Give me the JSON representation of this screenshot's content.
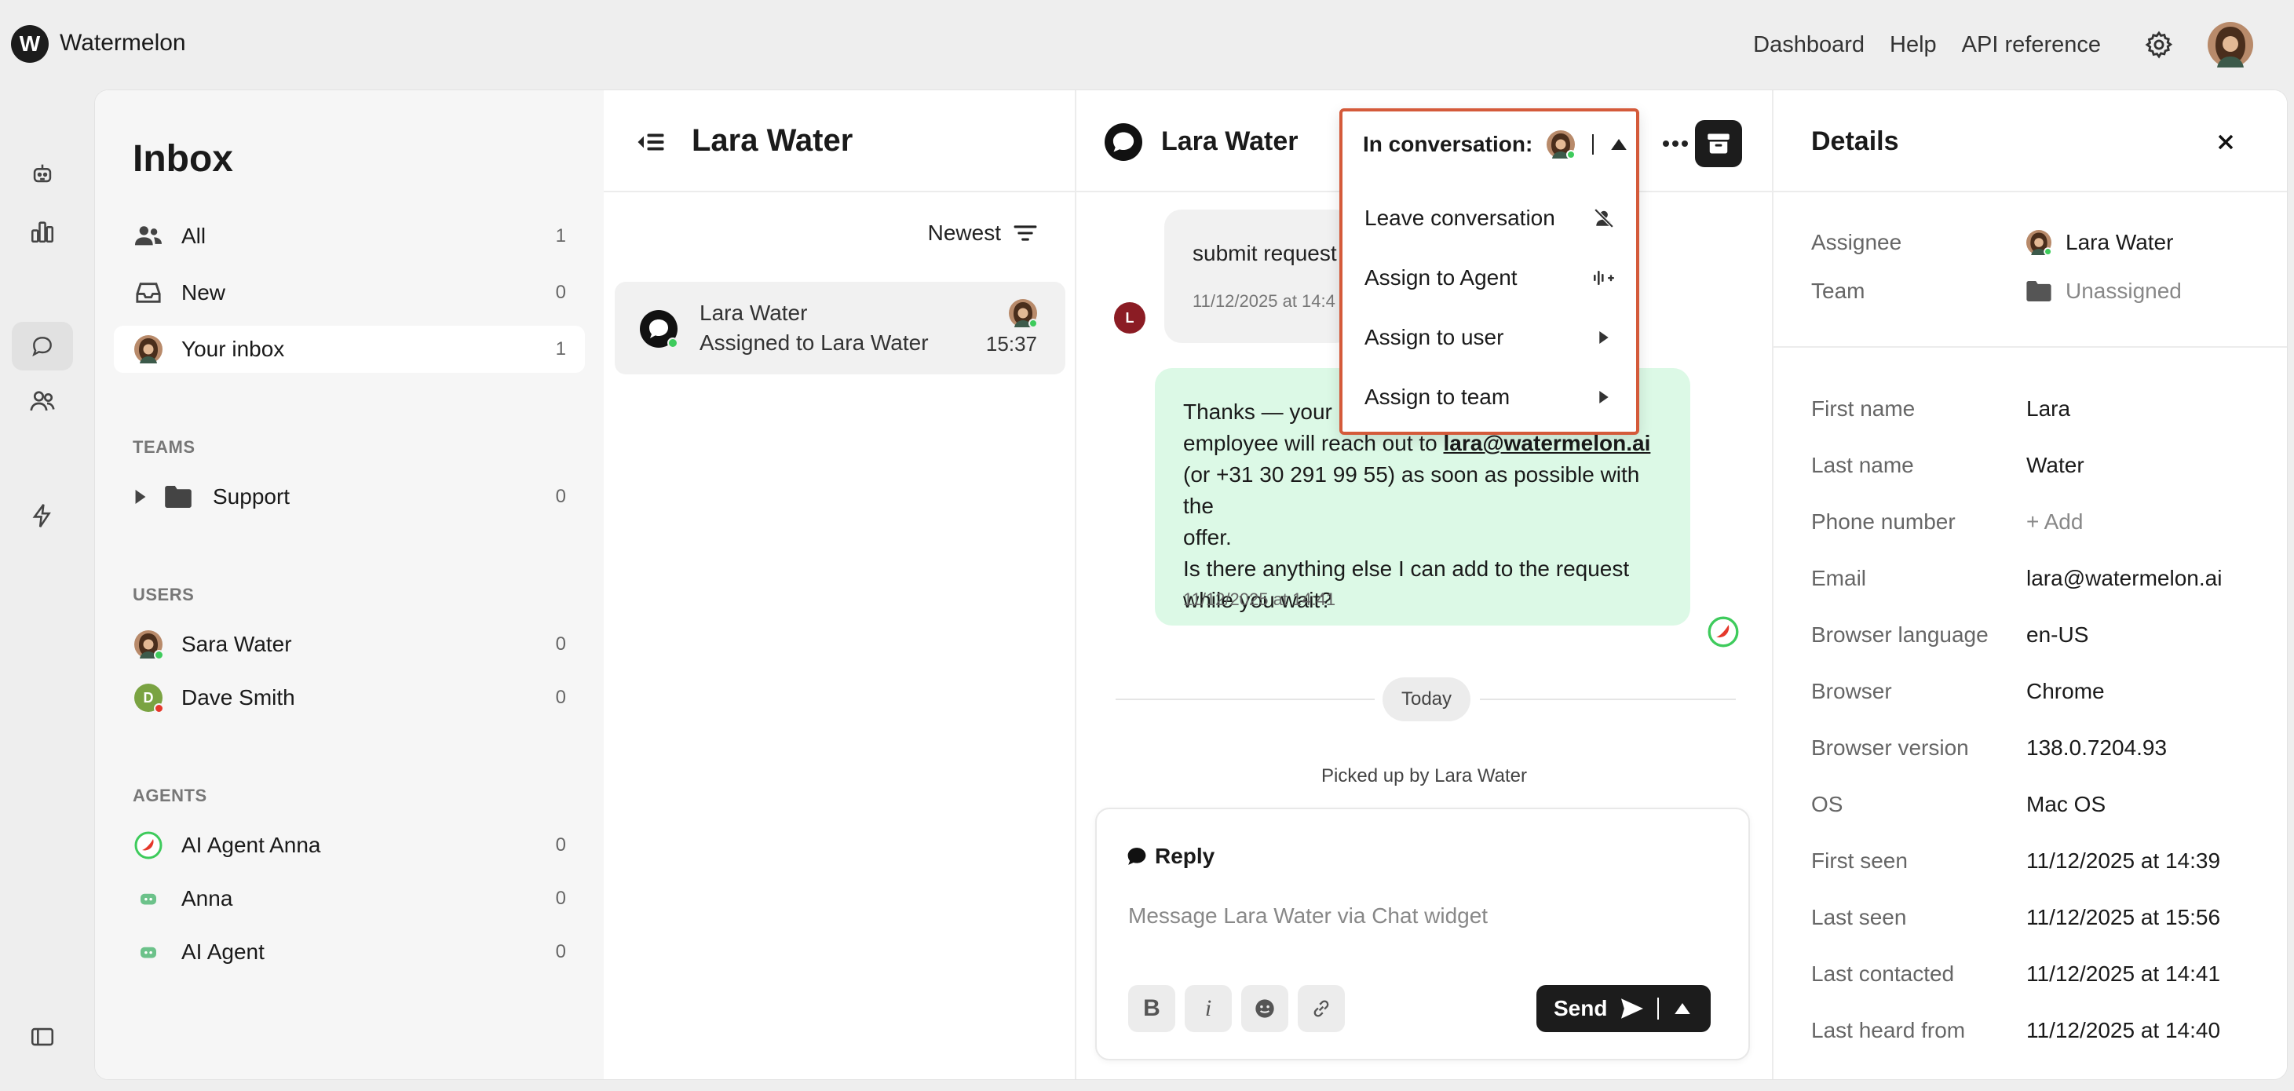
{
  "app": {
    "logo_letter": "W",
    "name": "Watermelon"
  },
  "topnav": {
    "links": [
      "Dashboard",
      "Help",
      "API reference"
    ]
  },
  "inbox": {
    "title": "Inbox",
    "items": [
      {
        "label": "All",
        "count": "1"
      },
      {
        "label": "New",
        "count": "0"
      },
      {
        "label": "Your inbox",
        "count": "1"
      }
    ],
    "teams_title": "TEAMS",
    "teams": [
      {
        "label": "Support",
        "count": "0"
      }
    ],
    "users_title": "USERS",
    "users": [
      {
        "label": "Sara Water",
        "count": "0",
        "initial": "",
        "status_color": "#3ecb5c"
      },
      {
        "label": "Dave Smith",
        "count": "0",
        "initial": "D",
        "status_color": "#e5382b"
      }
    ],
    "agents_title": "AGENTS",
    "agents": [
      {
        "label": "AI Agent Anna",
        "count": "0"
      },
      {
        "label": "Anna",
        "count": "0"
      },
      {
        "label": "AI Agent",
        "count": "0"
      }
    ]
  },
  "list": {
    "title": "Lara Water",
    "sort_label": "Newest",
    "conversation": {
      "name": "Lara Water",
      "subtitle": "Assigned to Lara Water",
      "time": "15:37"
    }
  },
  "conversation": {
    "title": "Lara Water",
    "in_conversation_label": "In conversation:",
    "user_message": {
      "text": "submit request",
      "time": "11/12/2025 at 14:4",
      "avatar_initial": "L"
    },
    "agent_message": {
      "line1": "Thanks — your r",
      "line2_prefix": "employee will reach out to ",
      "email": "lara@watermelon.ai",
      "line3": "(or +31 30 291 99 55) as soon as possible with the",
      "line4": "offer.",
      "line5": "Is there anything else I can add to the request",
      "line6": "while you wait?",
      "time": "11/12/2025 at 14:41"
    },
    "date_divider": "Today",
    "system_note": "Picked up by Lara Water",
    "reply": {
      "label": "Reply",
      "placeholder": "Message Lara Water via Chat widget",
      "bold": "B",
      "italic": "i",
      "send_label": "Send"
    }
  },
  "dropdown": {
    "trigger_label": "In conversation:",
    "items": [
      {
        "label": "Leave conversation",
        "icon": "user-remove-icon"
      },
      {
        "label": "Assign to Agent",
        "icon": "agent-assign-icon"
      },
      {
        "label": "Assign to user",
        "icon": "caret-right-icon"
      },
      {
        "label": "Assign to team",
        "icon": "caret-right-icon"
      }
    ]
  },
  "details": {
    "title": "Details",
    "assignee_label": "Assignee",
    "assignee_value": "Lara Water",
    "team_label": "Team",
    "team_value": "Unassigned",
    "fields": [
      {
        "key": "First name",
        "value": "Lara"
      },
      {
        "key": "Last name",
        "value": "Water"
      },
      {
        "key": "Phone number",
        "value": "+ Add"
      },
      {
        "key": "Email",
        "value": "lara@watermelon.ai"
      },
      {
        "key": "Browser language",
        "value": "en-US"
      },
      {
        "key": "Browser",
        "value": "Chrome"
      },
      {
        "key": "Browser version",
        "value": "138.0.7204.93"
      },
      {
        "key": "OS",
        "value": "Mac OS"
      },
      {
        "key": "First seen",
        "value": "11/12/2025 at 14:39"
      },
      {
        "key": "Last seen",
        "value": "11/12/2025 at 15:56"
      },
      {
        "key": "Last contacted",
        "value": "11/12/2025 at 14:41"
      },
      {
        "key": "Last heard from",
        "value": "11/12/2025 at 14:40"
      }
    ]
  },
  "colors": {
    "accent_highlight": "#d45a3a",
    "agent_bubble": "#dcf9e6",
    "online": "#3ecb5c",
    "dark": "#1c1c1c"
  }
}
